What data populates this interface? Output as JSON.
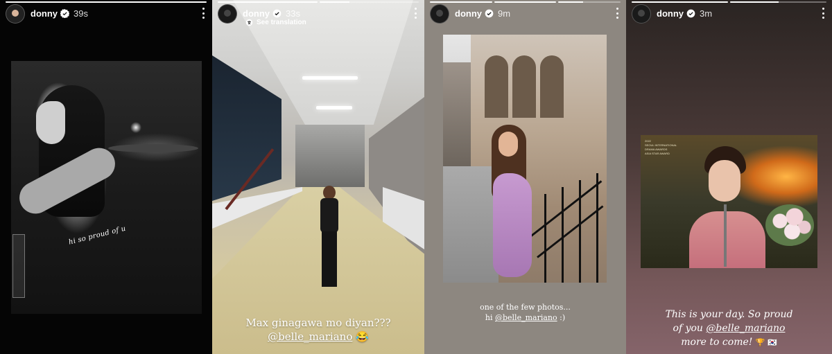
{
  "colors": {
    "accent": "#ffffff",
    "verified": "#ffffff"
  },
  "stories": [
    {
      "username": "donny",
      "timestamp": "39s",
      "caption": "hi so proud of u",
      "progress": [
        1.0
      ]
    },
    {
      "username": "donny",
      "timestamp": "33s",
      "translation": "See translation",
      "caption_line1": "Max ginagawa mo diyan???",
      "caption_mention": "@belle_mariano",
      "caption_emoji": "😂",
      "progress": [
        1.0,
        0.3
      ]
    },
    {
      "username": "donny",
      "timestamp": "9m",
      "caption_line1": "one of the few photos...",
      "caption_prefix": "hi ",
      "caption_mention": "@belle_mariano",
      "caption_suffix": " :)",
      "progress": [
        1.0,
        1.0,
        0.4
      ]
    },
    {
      "username": "donny",
      "timestamp": "3m",
      "caption_line1": "This is your day. So proud",
      "caption_line2_prefix": "of you ",
      "caption_mention": "@belle_mariano",
      "caption_line3": "more to come! ",
      "caption_emoji": "🏆 🇰🇷",
      "award_text_1": "2022",
      "award_text_2": "SEOUL INTERNATIONAL",
      "award_text_3": "DRAMA AWARDS",
      "award_text_4": "ASIA STAR AWARD",
      "progress": [
        1.0,
        0.5
      ]
    }
  ],
  "icons": {
    "verified": "verified-badge-icon",
    "more": "more-options-icon",
    "translate": "translate-icon"
  }
}
